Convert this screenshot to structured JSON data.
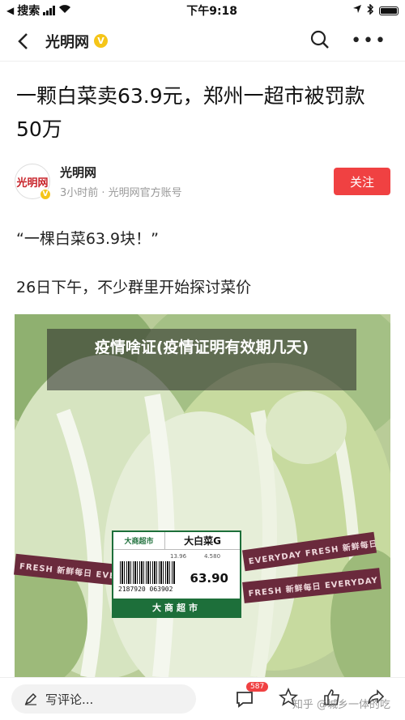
{
  "status_bar": {
    "carrier": "搜索",
    "time": "下午9:18"
  },
  "nav": {
    "title": "光明网",
    "verified": "V"
  },
  "article": {
    "headline": "一颗白菜卖63.9元，郑州一超市被罚款50万",
    "author": {
      "avatar_text": "光明网",
      "name": "光明网",
      "meta": "3小时前 · 光明网官方账号",
      "follow_label": "关注"
    },
    "paragraphs": [
      "“一棵白菜63.9块！”",
      "26日下午，不少群里开始探讨菜价"
    ],
    "image_overlay": "疫情啥证(疫情证明有效期几天)",
    "price_tag": {
      "store": "大商超市",
      "product": "大白菜G",
      "barcode_number": "2187920 063902",
      "price": "63.90",
      "footer": "大商超市",
      "weight": "13.96",
      "unit_price": "4.580"
    },
    "tape_text_top": "EVERYDAY FRESH 新鲜每日 EVERYDAY",
    "tape_text_bottom": "FRESH 新鲜每日 EVERYDAY FRESH 新鲜"
  },
  "bottom_bar": {
    "comment_placeholder": "写评论...",
    "comment_count": "587",
    "watermark": "知乎 @城乡一体的吃"
  },
  "colors": {
    "follow": "#f04142",
    "verified": "#f5c518",
    "tag_green": "#1d6f3a"
  }
}
